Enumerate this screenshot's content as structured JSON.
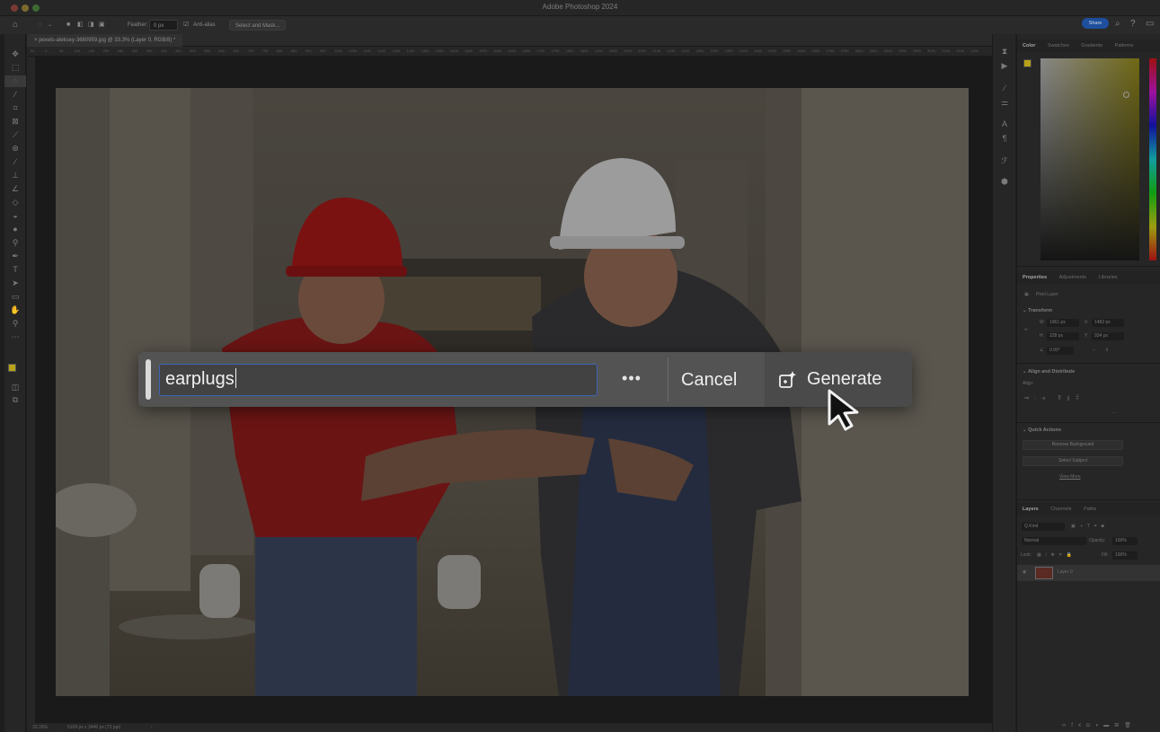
{
  "window": {
    "title": "Adobe Photoshop 2024"
  },
  "options_bar": {
    "feather_label": "Feather:",
    "feather_value": "0 px",
    "antialias_label": "Anti-alias",
    "select_mask_label": "Select and Mask...",
    "share_label": "Share"
  },
  "document": {
    "tab_title": "pexels-aleksey-3680959.jpg @ 33.3% (Layer 0, RGB/8) *",
    "ruler_ticks": [
      "50",
      "0",
      "50",
      "100",
      "150",
      "200",
      "250",
      "300",
      "350",
      "400",
      "450",
      "500",
      "550",
      "600",
      "650",
      "700",
      "750",
      "800",
      "850",
      "900",
      "950",
      "1000",
      "1050",
      "1100",
      "1150",
      "1200",
      "1250",
      "1300",
      "1350",
      "1400",
      "1450",
      "1500",
      "1550",
      "1600",
      "1650",
      "1700",
      "1750",
      "1800",
      "1850",
      "1900",
      "1950",
      "2000",
      "2050",
      "2100",
      "2150",
      "2200",
      "2250",
      "2300",
      "2350",
      "2400",
      "2450",
      "2500",
      "2550",
      "2600",
      "2650",
      "2700",
      "2750",
      "2800",
      "2850",
      "2900",
      "2950",
      "3000",
      "3050",
      "3100",
      "3150",
      "3200"
    ],
    "zoom": "33.33%",
    "doc_size": "5169 px x 3446 px (72 ppi)",
    "status_arrow": "›"
  },
  "generative_fill": {
    "prompt_value": "earplugs",
    "more_label": "•••",
    "cancel_label": "Cancel",
    "generate_label": "Generate"
  },
  "color_panel": {
    "tabs": [
      "Color",
      "Swatches",
      "Gradients",
      "Patterns"
    ]
  },
  "properties_panel": {
    "tabs": [
      "Properties",
      "Adjustments",
      "Libraries"
    ],
    "layer_type": "Pixel Layer",
    "transform_title": "Transform",
    "w_label": "W",
    "w_value": "1961 px",
    "x_label": "X",
    "x_value": "1482 px",
    "h_label": "H",
    "h_value": "228 px",
    "y_label": "Y",
    "y_value": "934 px",
    "angle_value": "0.00°",
    "align_title": "Align and Distribute",
    "align_label": "Align:",
    "quick_actions_title": "Quick Actions",
    "remove_bg_label": "Remove Background",
    "select_subject_label": "Select Subject",
    "view_more_label": "View More"
  },
  "layers_panel": {
    "tabs": [
      "Layers",
      "Channels",
      "Paths"
    ],
    "kind_label": "Q Kind",
    "blend_mode": "Normal",
    "opacity_label": "Opacity:",
    "opacity_value": "100%",
    "lock_label": "Lock:",
    "fill_label": "Fill:",
    "fill_value": "100%",
    "layer_name": "Layer 0"
  },
  "colors": {
    "accent_blue": "#3d63b6",
    "foreground_swatch": "#b8a21a",
    "background_swatch": "#d8d8d8"
  }
}
